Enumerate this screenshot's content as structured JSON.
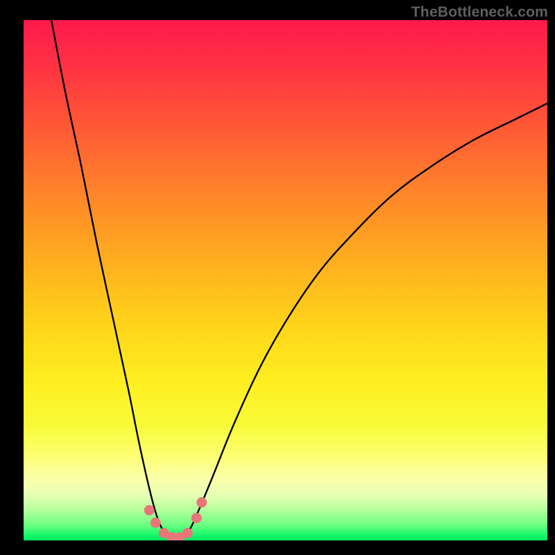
{
  "watermark": "TheBottleneck.com",
  "chart_data": {
    "type": "line",
    "title": "",
    "xlabel": "",
    "ylabel": "",
    "xlim": [
      0,
      100
    ],
    "ylim": [
      0,
      100
    ],
    "grid": false,
    "legend": false,
    "background_gradient": {
      "direction": "vertical",
      "stops": [
        {
          "pos": 0.0,
          "color": "#ff1a4b"
        },
        {
          "pos": 0.5,
          "color": "#ffba1d"
        },
        {
          "pos": 0.85,
          "color": "#fdff76"
        },
        {
          "pos": 1.0,
          "color": "#00e763"
        }
      ],
      "meaning": "top=red=high bottleneck, bottom=green=low bottleneck"
    },
    "series": [
      {
        "name": "bottleneck-curve",
        "color": "#000000",
        "x": [
          5.3,
          8,
          11,
          14,
          17,
          20,
          22,
          24,
          25.5,
          27,
          28.5,
          30,
          31.5,
          33,
          36,
          40,
          45,
          50,
          56,
          62,
          70,
          78,
          86,
          94,
          100
        ],
        "y": [
          100,
          86,
          72,
          57,
          43,
          29,
          19,
          10,
          4.5,
          1.3,
          0.4,
          0.6,
          1.8,
          4.8,
          12,
          22,
          33,
          42,
          51,
          58,
          66,
          72,
          77,
          81,
          84
        ]
      }
    ],
    "markers": [
      {
        "name": "dot",
        "color": "#e9757a",
        "r": 1.0,
        "x": 24.0,
        "y": 5.8
      },
      {
        "name": "dot",
        "color": "#e9757a",
        "r": 1.0,
        "x": 25.2,
        "y": 3.4
      },
      {
        "name": "dot",
        "color": "#e9757a",
        "r": 1.0,
        "x": 26.8,
        "y": 1.4
      },
      {
        "name": "dot",
        "color": "#e9757a",
        "r": 1.0,
        "x": 28.3,
        "y": 0.6
      },
      {
        "name": "dot",
        "color": "#e9757a",
        "r": 1.0,
        "x": 29.8,
        "y": 0.6
      },
      {
        "name": "dot",
        "color": "#e9757a",
        "r": 1.0,
        "x": 31.3,
        "y": 1.4
      },
      {
        "name": "dot",
        "color": "#e9757a",
        "r": 1.0,
        "x": 33.0,
        "y": 4.3
      },
      {
        "name": "dot",
        "color": "#e9757a",
        "r": 1.0,
        "x": 34.0,
        "y": 7.3
      }
    ]
  }
}
